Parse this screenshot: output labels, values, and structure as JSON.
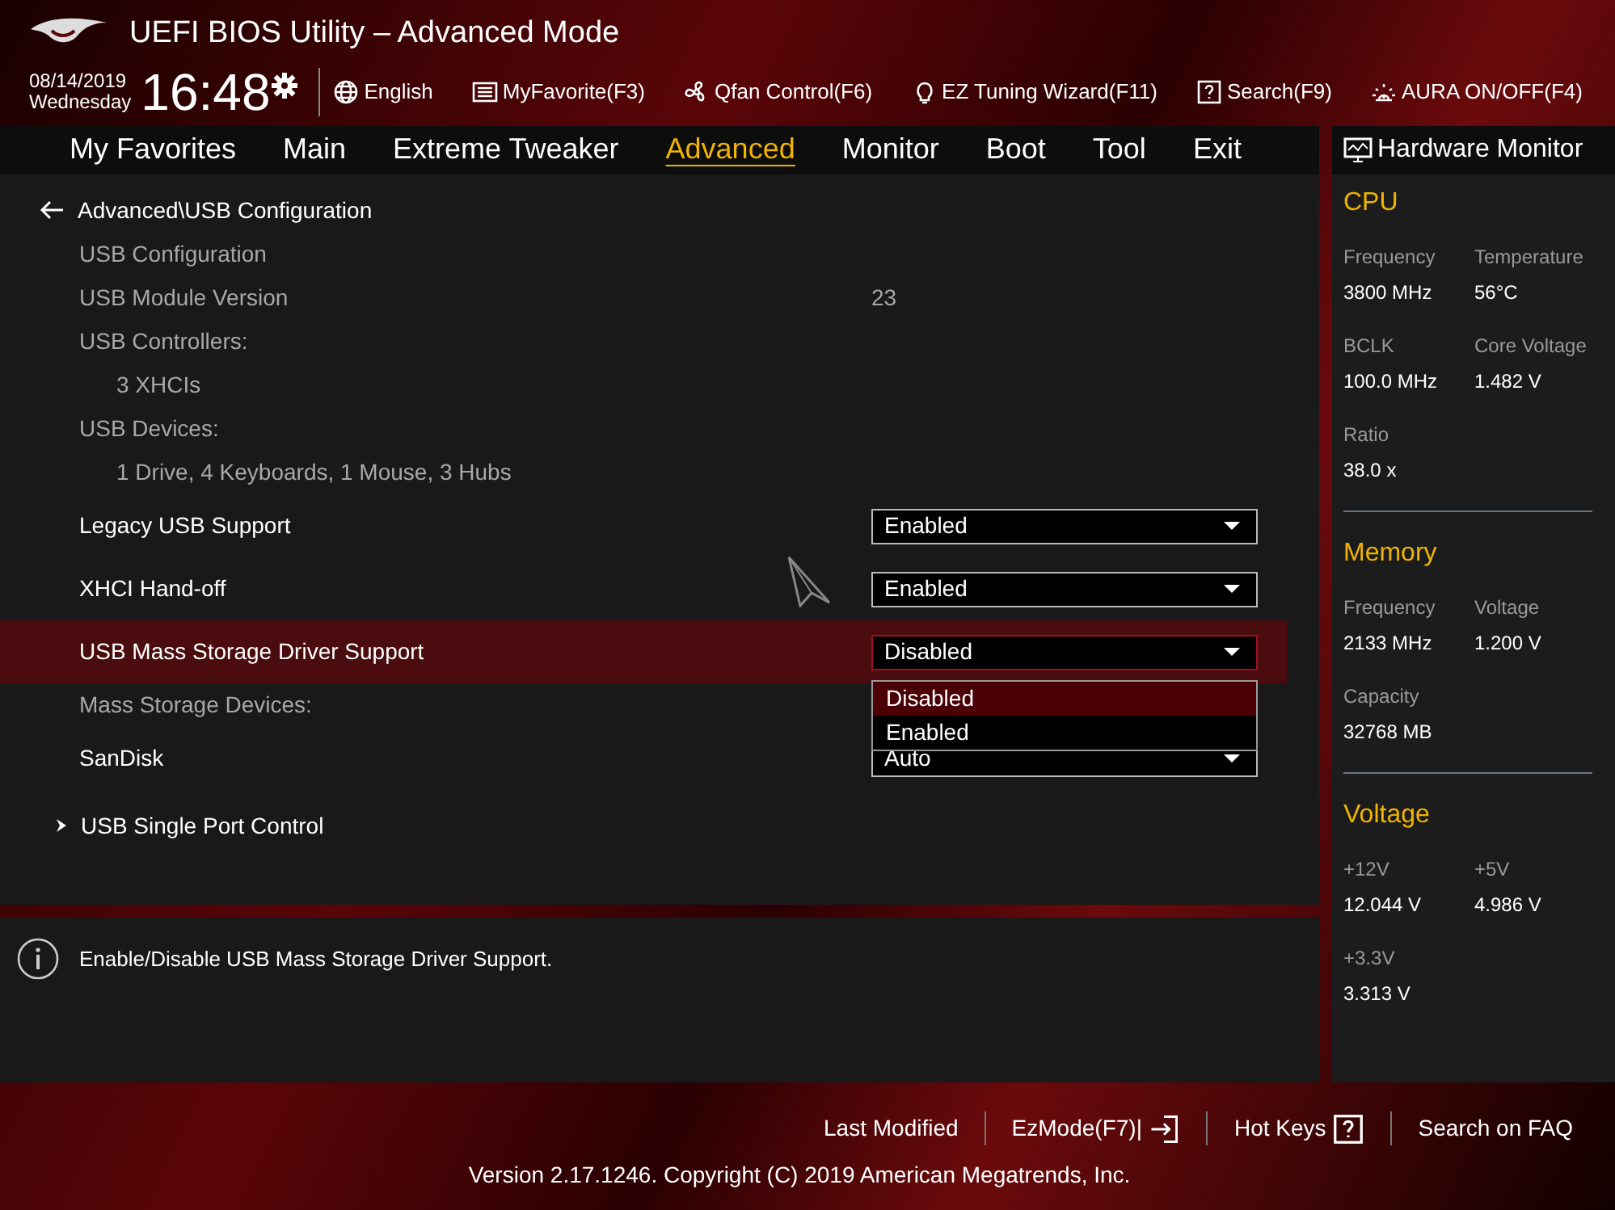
{
  "window": {
    "title": "UEFI BIOS Utility – Advanced Mode"
  },
  "header": {
    "date": "08/14/2019",
    "day": "Wednesday",
    "time": "16:48",
    "tools": [
      {
        "label": "English"
      },
      {
        "label": "MyFavorite(F3)"
      },
      {
        "label": "Qfan Control(F6)"
      },
      {
        "label": "EZ Tuning Wizard(F11)"
      },
      {
        "label": "Search(F9)"
      },
      {
        "label": "AURA ON/OFF(F4)"
      }
    ]
  },
  "menu": [
    {
      "label": "My Favorites",
      "selected": false
    },
    {
      "label": "Main",
      "selected": false
    },
    {
      "label": "Extreme Tweaker",
      "selected": false
    },
    {
      "label": "Advanced",
      "selected": true
    },
    {
      "label": "Monitor",
      "selected": false
    },
    {
      "label": "Boot",
      "selected": false
    },
    {
      "label": "Tool",
      "selected": false
    },
    {
      "label": "Exit",
      "selected": false
    }
  ],
  "breadcrumb": "Advanced\\USB Configuration",
  "rows": [
    {
      "kind": "info",
      "label": "USB Configuration",
      "selected": false
    },
    {
      "kind": "info",
      "label": "USB Module Version",
      "value": "23",
      "selected": false
    },
    {
      "kind": "info",
      "label": "USB Controllers:",
      "selected": false
    },
    {
      "kind": "sub",
      "label": "3 XHCIs",
      "selected": false
    },
    {
      "kind": "info",
      "label": "USB Devices:",
      "selected": false
    },
    {
      "kind": "sub",
      "label": "1 Drive, 4 Keyboards, 1 Mouse, 3 Hubs",
      "selected": false
    },
    {
      "kind": "setting",
      "label": "Legacy USB Support",
      "value": "Enabled",
      "selected": false,
      "expanded": false
    },
    {
      "kind": "setting",
      "label": "XHCI Hand-off",
      "value": "Enabled",
      "selected": false,
      "expanded": false
    },
    {
      "kind": "setting",
      "label": "USB Mass Storage Driver Support",
      "value": "Disabled",
      "selected": true,
      "expanded": true,
      "options": [
        {
          "label": "Disabled",
          "selected": true
        },
        {
          "label": "Enabled",
          "selected": false
        }
      ]
    },
    {
      "kind": "info",
      "label": "Mass Storage Devices:",
      "selected": false
    },
    {
      "kind": "setting",
      "label": "SanDisk",
      "value": "Auto",
      "selected": false,
      "expanded": false
    },
    {
      "kind": "submenu",
      "label": "USB Single Port Control",
      "selected": false
    }
  ],
  "help": "Enable/Disable USB Mass Storage Driver Support.",
  "hardware_monitor": {
    "title": "Hardware Monitor",
    "sections": [
      {
        "title": "CPU",
        "items": [
          {
            "label": "Frequency",
            "value": "3800 MHz"
          },
          {
            "label": "Temperature",
            "value": "56°C"
          },
          {
            "label": "BCLK",
            "value": "100.0 MHz"
          },
          {
            "label": "Core Voltage",
            "value": "1.482 V"
          },
          {
            "label": "Ratio",
            "value": "38.0 x"
          }
        ]
      },
      {
        "title": "Memory",
        "items": [
          {
            "label": "Frequency",
            "value": "2133 MHz"
          },
          {
            "label": "Voltage",
            "value": "1.200 V"
          },
          {
            "label": "Capacity",
            "value": "32768 MB"
          }
        ]
      },
      {
        "title": "Voltage",
        "items": [
          {
            "label": "+12V",
            "value": "12.044 V"
          },
          {
            "label": "+5V",
            "value": "4.986 V"
          },
          {
            "label": "+3.3V",
            "value": "3.313 V"
          }
        ]
      }
    ]
  },
  "footer": {
    "links": [
      {
        "label": "Last Modified"
      },
      {
        "label": "EzMode(F7)|"
      },
      {
        "label": "Hot Keys"
      },
      {
        "label": "Search on FAQ"
      }
    ],
    "version": "Version 2.17.1246. Copyright (C) 2019 American Megatrends, Inc."
  }
}
